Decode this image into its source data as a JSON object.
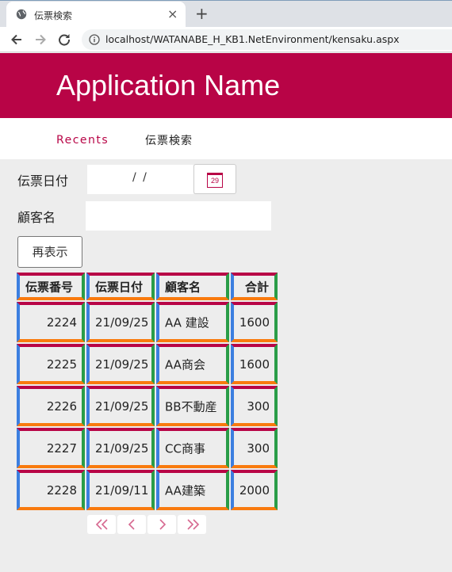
{
  "browser": {
    "tab_title": "伝票検索",
    "close_glyph": "×",
    "newtab_glyph": "+",
    "url": "localhost/WATANABE_H_KB1.NetEnvironment/kensaku.aspx"
  },
  "app": {
    "title": "Application Name",
    "nav": {
      "recents": "Recents",
      "search": "伝票検索"
    }
  },
  "form": {
    "date_label": "伝票日付",
    "date_value": "/ /",
    "calendar_day": "29",
    "customer_label": "顧客名",
    "customer_value": "",
    "redisplay_button": "再表示"
  },
  "table": {
    "columns": [
      "伝票番号",
      "伝票日付",
      "顧客名",
      "合計"
    ],
    "rows": [
      [
        "2224",
        "21/09/25",
        "AA 建設",
        "1600"
      ],
      [
        "2225",
        "21/09/25",
        "AA商会",
        "1600"
      ],
      [
        "2226",
        "21/09/25",
        "BB不動産",
        "300"
      ],
      [
        "2227",
        "21/09/25",
        "CC商事",
        "300"
      ],
      [
        "2228",
        "21/09/11",
        "AA建築",
        "2000"
      ]
    ]
  },
  "pager": {
    "buttons": [
      "first-page",
      "previous-page",
      "next-page",
      "last-page"
    ]
  },
  "colors": {
    "brand": "#b80446",
    "cell_top": "#b80446",
    "cell_bottom": "#f97a0e",
    "cell_left": "#3c7fe0",
    "cell_right": "#2a9d48",
    "page_bg": "#ededed"
  },
  "icons": [
    "globe-icon",
    "close-icon",
    "plus-icon",
    "back-arrow-icon",
    "forward-arrow-icon",
    "reload-icon",
    "info-icon",
    "calendar-icon",
    "double-chevron-left-icon",
    "chevron-left-icon",
    "chevron-right-icon",
    "double-chevron-right-icon"
  ]
}
